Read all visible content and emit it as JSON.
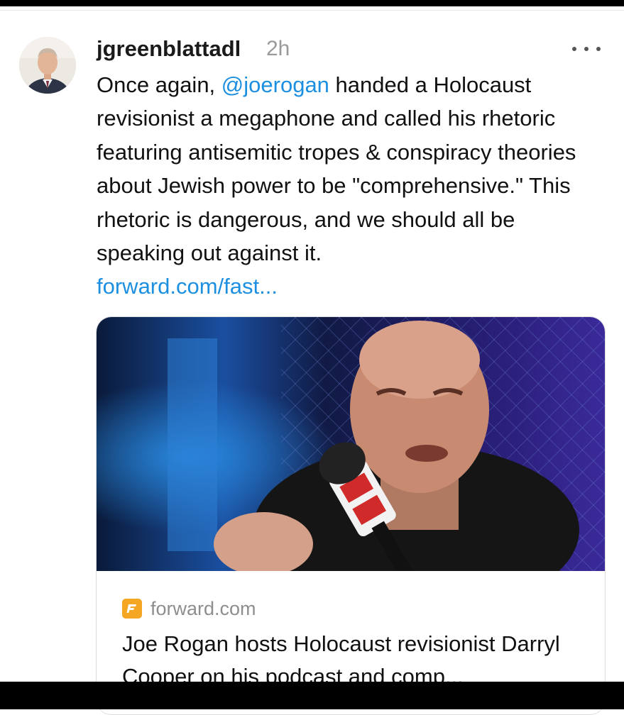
{
  "post": {
    "username": "jgreenblattadl",
    "timestamp": "2h",
    "more_icon": "ellipsis-icon",
    "body": {
      "text_before_mention": "Once again, ",
      "mention": "@joerogan",
      "text_after_mention": " handed a Holocaust revisionist a megaphone and called his rhetoric featuring antisemitic tropes & conspiracy theories about Jewish power to be \"comprehensive.\" This rhetoric is dangerous, and we should all be speaking out against it.",
      "link": "forward.com/fast..."
    }
  },
  "link_card": {
    "source_domain": "forward.com",
    "source_logo_letter": "F",
    "title": "Joe Rogan hosts Holocaust revisionist Darryl Cooper on his podcast and comp..."
  },
  "colors": {
    "link": "#1d8fe0",
    "timestamp": "#9a9a9a",
    "source_logo": "#f5a623"
  }
}
